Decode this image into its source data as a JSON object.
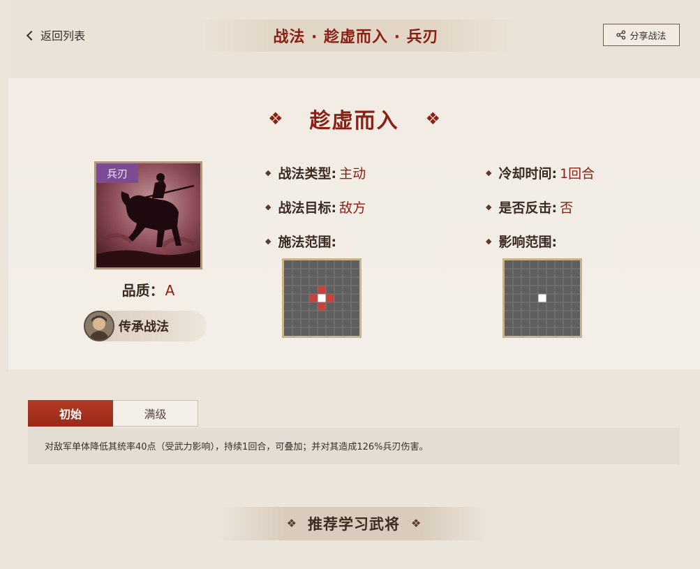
{
  "header": {
    "back_label": "返回列表",
    "title": "战法 · 趁虚而入 · 兵刃",
    "share_label": "分享战法"
  },
  "skill": {
    "name": "趁虚而入",
    "type_tag": "兵刃",
    "quality_label": "品质：",
    "quality_value": "A",
    "inherit_label": "传承战法"
  },
  "attributes": {
    "type": {
      "key": "战法类型:",
      "value": "主动"
    },
    "target": {
      "key": "战法目标:",
      "value": "敌方"
    },
    "cast_range": {
      "key": "施法范围:"
    },
    "cooldown": {
      "key": "冷却时间:",
      "value": "1回合"
    },
    "counter": {
      "key": "是否反击:",
      "value": "否"
    },
    "effect_range": {
      "key": "影响范围:"
    }
  },
  "tabs": [
    {
      "label": "初始",
      "active": true
    },
    {
      "label": "满级",
      "active": false
    }
  ],
  "description": "对敌军单体降低其统率40点（受武力影响），持续1回合，可叠加；并对其造成126%兵刃伤害。",
  "recommend_title": "推荐学习武将",
  "colors": {
    "accent_red": "#8a1f13",
    "tab_active": "#b33a25",
    "type_tag_purple": "#7d4b94",
    "grid_bg": "#5f5f5f",
    "range_red": "#c9423a"
  }
}
